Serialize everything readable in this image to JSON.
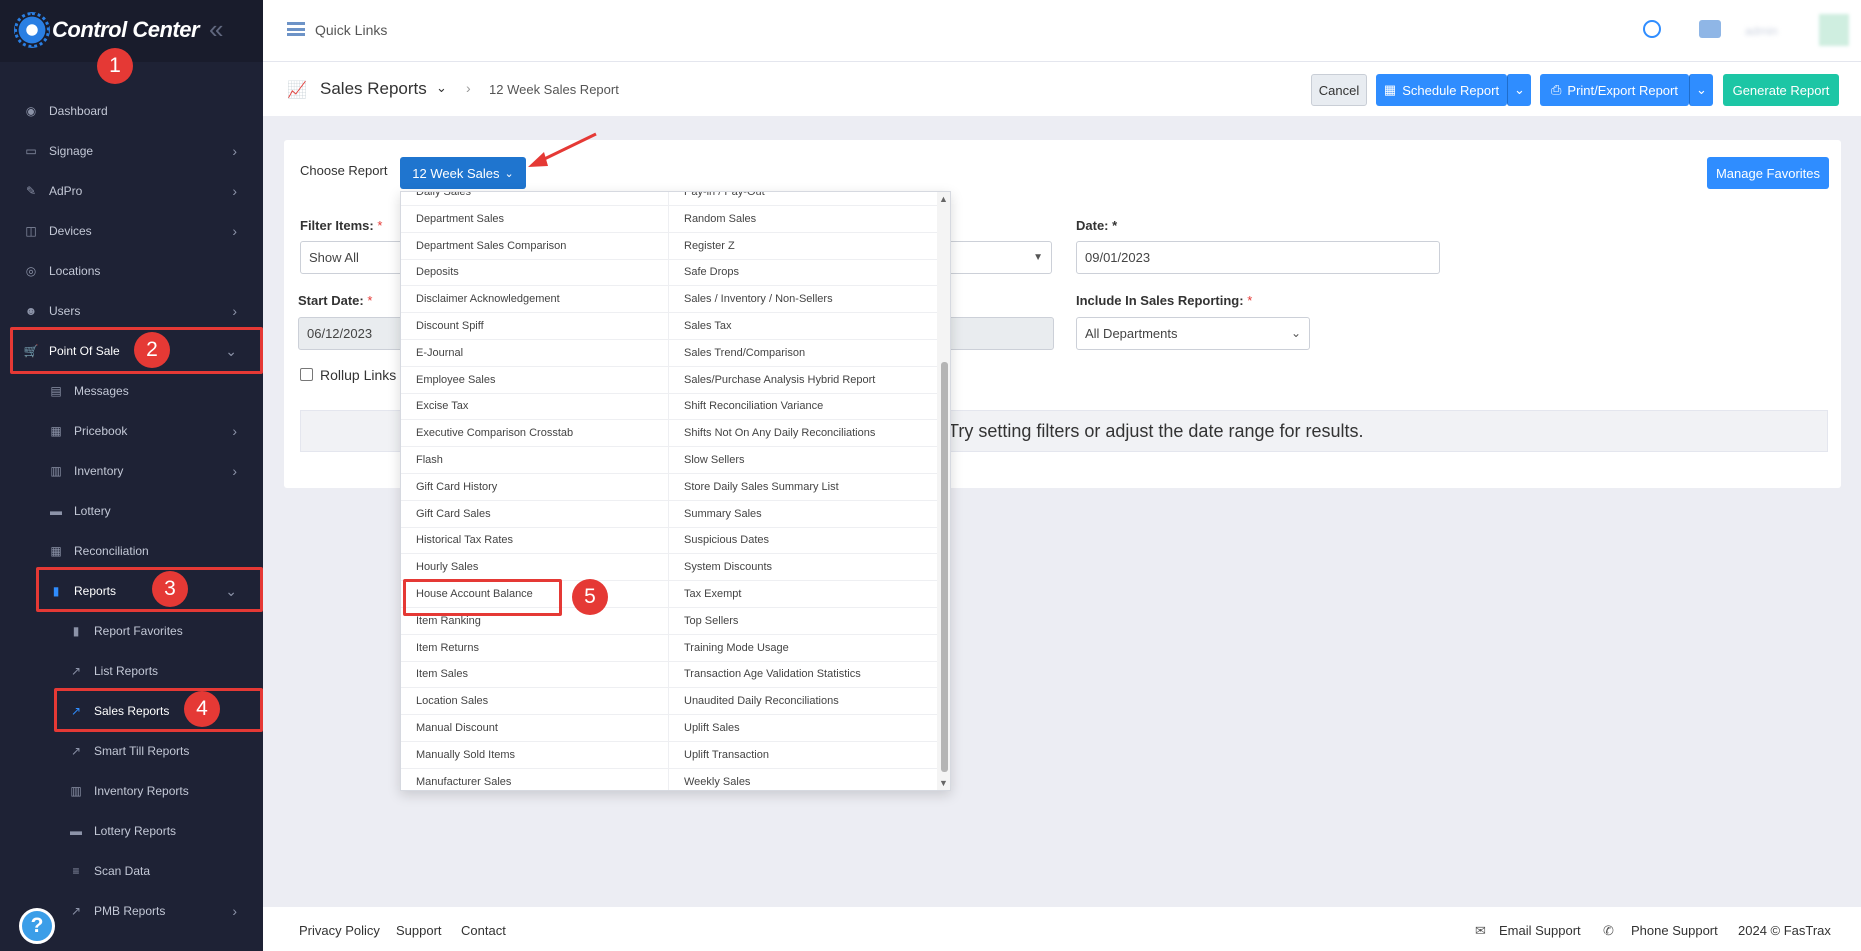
{
  "app": {
    "title": "Control Center"
  },
  "sidebar": {
    "items": [
      {
        "label": "Dashboard",
        "icon": "dashboard-icon"
      },
      {
        "label": "Signage",
        "icon": "monitor-icon"
      },
      {
        "label": "AdPro",
        "icon": "brush-icon"
      },
      {
        "label": "Devices",
        "icon": "devices-icon"
      },
      {
        "label": "Locations",
        "icon": "location-pin-icon"
      },
      {
        "label": "Users",
        "icon": "users-icon"
      },
      {
        "label": "Point Of Sale",
        "icon": "cart-icon"
      },
      {
        "label": "Messages",
        "icon": "message-icon"
      },
      {
        "label": "Pricebook",
        "icon": "book-icon"
      },
      {
        "label": "Inventory",
        "icon": "inventory-icon"
      },
      {
        "label": "Lottery",
        "icon": "ticket-icon"
      },
      {
        "label": "Reconciliation",
        "icon": "grid-icon"
      },
      {
        "label": "Reports",
        "icon": "bar-chart-icon"
      },
      {
        "label": "Report Favorites",
        "icon": "bookmark-icon"
      },
      {
        "label": "List Reports",
        "icon": "line-chart-icon"
      },
      {
        "label": "Sales Reports",
        "icon": "line-chart-icon"
      },
      {
        "label": "Smart Till Reports",
        "icon": "line-chart-icon"
      },
      {
        "label": "Inventory Reports",
        "icon": "inventory-icon"
      },
      {
        "label": "Lottery Reports",
        "icon": "ticket-icon"
      },
      {
        "label": "Scan Data",
        "icon": "list-icon"
      },
      {
        "label": "PMB Reports",
        "icon": "line-chart-icon"
      }
    ]
  },
  "annotations": [
    "1",
    "2",
    "3",
    "4",
    "5"
  ],
  "header": {
    "quick_links": "Quick Links",
    "user": "admin"
  },
  "page": {
    "title": "Sales Reports",
    "breadcrumb": "12 Week Sales Report",
    "cancel": "Cancel",
    "schedule": "Schedule Report",
    "print_export": "Print/Export Report",
    "generate": "Generate Report"
  },
  "form": {
    "choose_report_label": "Choose Report",
    "choose_report_value": "12 Week Sales",
    "manage_favorites": "Manage Favorites",
    "filter_items_label": "Filter Items:",
    "filter_items_value": "Show All",
    "date_label": "Date:",
    "date_value": "09/01/2023",
    "start_date_label": "Start Date:",
    "start_date_value": "06/12/2023",
    "include_label": "Include In Sales Reporting:",
    "include_value": "All Departments",
    "rollup_label": "Rollup Links",
    "empty_message": "Try setting filters or adjust the date range for results.",
    "required_mark": "*"
  },
  "dropdown": {
    "col1": [
      "Daily Sales",
      "Department Sales",
      "Department Sales Comparison",
      "Deposits",
      "Disclaimer Acknowledgement",
      "Discount Spiff",
      "E-Journal",
      "Employee Sales",
      "Excise Tax",
      "Executive Comparison Crosstab",
      "Flash",
      "Gift Card History",
      "Gift Card Sales",
      "Historical Tax Rates",
      "Hourly Sales",
      "House Account Balance",
      "Item Ranking",
      "Item Returns",
      "Item Sales",
      "Location Sales",
      "Manual Discount",
      "Manually Sold Items",
      "Manufacturer Sales"
    ],
    "col2": [
      "Pay-in / Pay-Out",
      "Random Sales",
      "Register Z",
      "Safe Drops",
      "Sales / Inventory / Non-Sellers",
      "Sales Tax",
      "Sales Trend/Comparison",
      "Sales/Purchase Analysis Hybrid Report",
      "Shift Reconciliation Variance",
      "Shifts Not On Any Daily Reconciliations",
      "Slow Sellers",
      "Store Daily Sales Summary List",
      "Summary Sales",
      "Suspicious Dates",
      "System Discounts",
      "Tax Exempt",
      "Top Sellers",
      "Training Mode Usage",
      "Transaction Age Validation Statistics",
      "Unaudited Daily Reconciliations",
      "Uplift Sales",
      "Uplift Transaction",
      "Weekly Sales"
    ]
  },
  "footer": {
    "privacy": "Privacy Policy",
    "support": "Support",
    "contact": "Contact",
    "email_support": "Email Support",
    "phone_support": "Phone Support",
    "copyright": "2024 © FasTrax"
  },
  "colors": {
    "accent": "#2f8dff",
    "sidebar": "#1e2235",
    "annotation": "#e53935",
    "generate": "#1cc6a5"
  }
}
